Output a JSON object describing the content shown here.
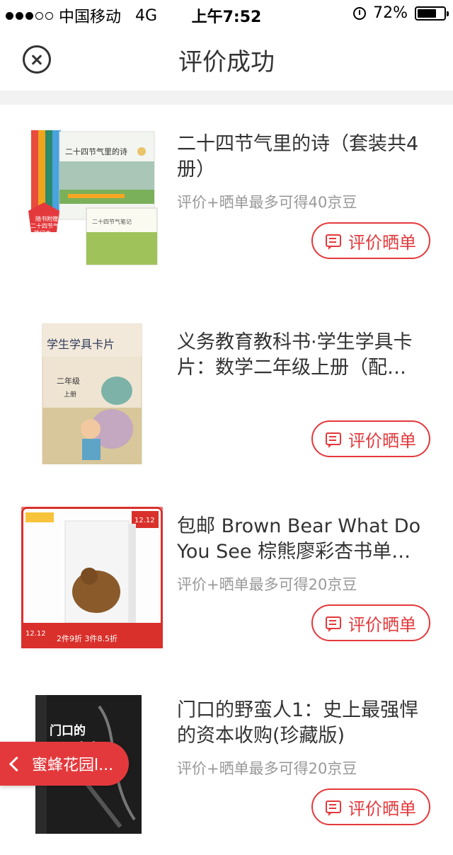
{
  "status_bar": {
    "signal_dots_filled": 3,
    "signal_dots_total": 5,
    "carrier": "中国移动",
    "network": "4G",
    "time": "上午7:52",
    "battery": "72%",
    "battery_level": 0.72
  },
  "nav": {
    "title": "评价成功",
    "close_icon": "close-circle-icon"
  },
  "items": [
    {
      "title": "二十四节气里的诗（套装共4册）",
      "subtitle": "评价+晒单最多可得40京豆",
      "button": "评价晒单",
      "image_text": [
        "二十四节气里的诗",
        "随书附赠",
        "二十四节气",
        "笔记本"
      ]
    },
    {
      "title": "义务教育教科书·学生学具卡片：数学二年级上册（配…",
      "subtitle": "",
      "button": "评价晒单",
      "image_text": [
        "学生学具卡片",
        "二年级",
        "上册"
      ]
    },
    {
      "title": "包邮 Brown Bear What Do You See 棕熊廖彩杏书单…",
      "subtitle": "评价+晒单最多可得20京豆",
      "button": "评价晒单",
      "image_text": [
        "12.12",
        "2件9折 3件8.5折"
      ]
    },
    {
      "title": "门口的野蛮人1：史上最强悍的资本收购(珍藏版)",
      "subtitle": "评价+晒单最多可得20京豆",
      "button": "评价晒单",
      "image_text": [
        "门口的",
        "野蛮人"
      ]
    }
  ],
  "floating_back": {
    "label": "蜜蜂花园l..."
  },
  "colors": {
    "accent": "#e4393c",
    "divider": "#f2f2f2",
    "muted_text": "#999999"
  }
}
